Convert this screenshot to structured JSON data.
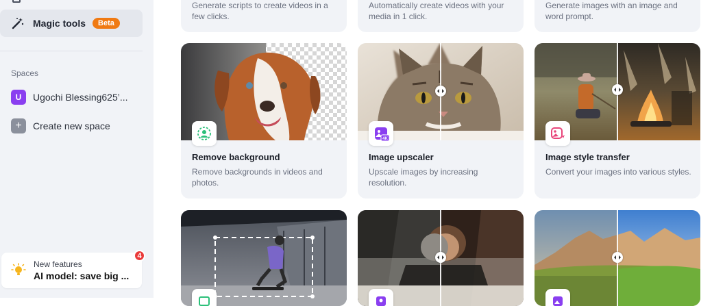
{
  "sidebar": {
    "active_item": {
      "label": "Magic tools",
      "badge": "Beta",
      "icon": "magic-wand-icon"
    },
    "spaces_heading": "Spaces",
    "spaces": [
      {
        "initial": "U",
        "label": "Ugochi Blessing625’..."
      },
      {
        "initial": "+",
        "label": "Create new space"
      }
    ],
    "new_features": {
      "small": "New features",
      "big": "AI model: save big ...",
      "count": "4",
      "icon": "lightbulb-icon"
    }
  },
  "top_cards": [
    {
      "desc": "Generate scripts to create videos in a few clicks."
    },
    {
      "desc": "Automatically create videos with your media in 1 click."
    },
    {
      "desc": "Generate images with an image and word prompt."
    }
  ],
  "tools": [
    {
      "title": "Remove background",
      "desc": "Remove backgrounds in videos and photos.",
      "icon": "remove-background-icon"
    },
    {
      "title": "Image upscaler",
      "desc": "Upscale images by increasing resolution.",
      "icon": "upscale-4k-icon",
      "icon_text": "4K"
    },
    {
      "title": "Image style transfer",
      "desc": "Convert your images into various styles.",
      "icon": "style-transfer-icon"
    }
  ],
  "colors": {
    "accent_purple": "#8a3ff0",
    "badge_orange": "#f07a12",
    "notif_red": "#ea3a3a",
    "green": "#2cc07a",
    "pink": "#e8457a"
  }
}
